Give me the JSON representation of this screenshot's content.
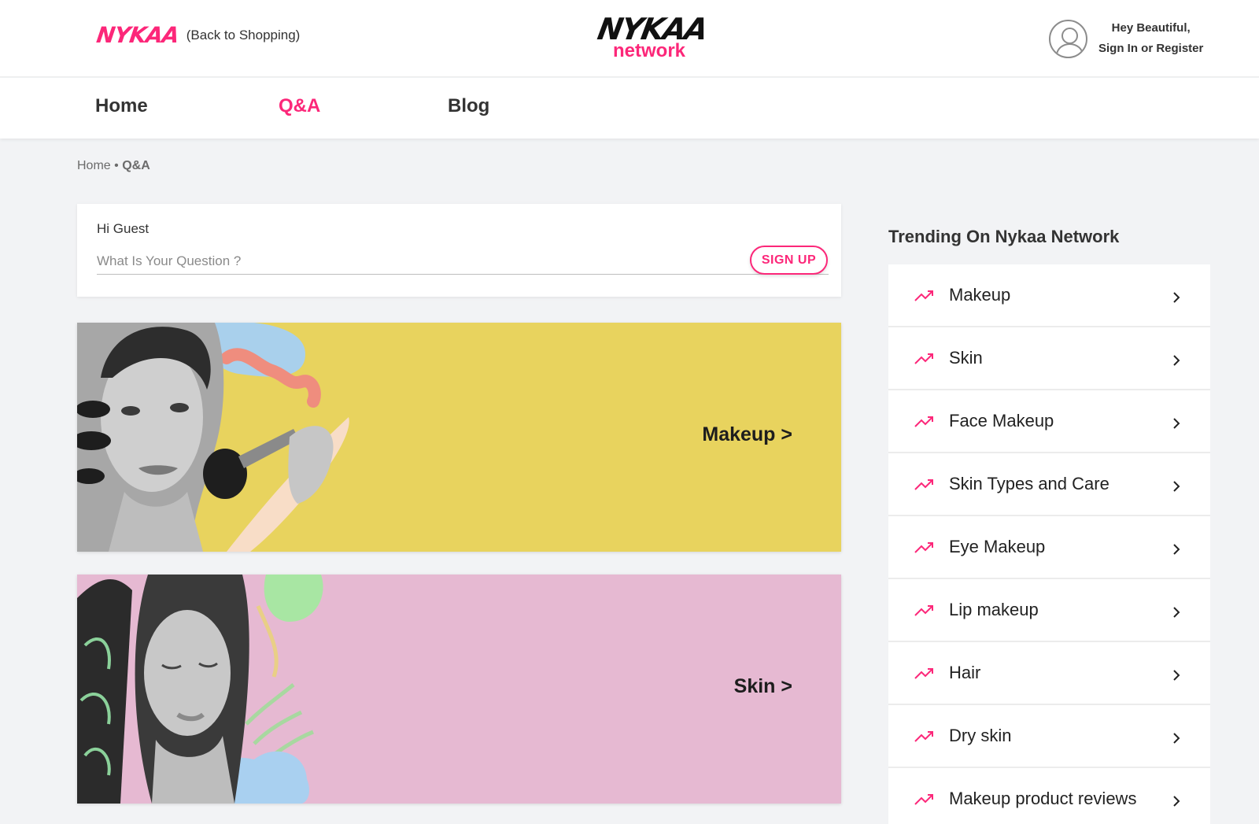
{
  "header": {
    "brand_small": "NYKAA",
    "back_link": "(Back to Shopping)",
    "logo_top": "NYKAA",
    "logo_bottom": "network",
    "user_greeting": "Hey Beautiful,",
    "user_action": "Sign In or Register"
  },
  "nav": {
    "items": [
      {
        "label": "Home"
      },
      {
        "label": "Q&A"
      },
      {
        "label": "Blog"
      }
    ],
    "active": "Q&A"
  },
  "breadcrumb": {
    "home": "Home",
    "separator": "•",
    "current": "Q&A"
  },
  "ask": {
    "greeting": "Hi Guest",
    "placeholder": "What Is Your Question ?",
    "signup_label": "SIGN UP"
  },
  "banners": [
    {
      "label": "Makeup >",
      "bg": "#e8d35e"
    },
    {
      "label": "Skin >",
      "bg": "#e6b9d2"
    }
  ],
  "trending": {
    "title": "Trending On Nykaa Network",
    "items": [
      {
        "label": "Makeup"
      },
      {
        "label": "Skin"
      },
      {
        "label": "Face Makeup"
      },
      {
        "label": "Skin Types and Care"
      },
      {
        "label": "Eye Makeup"
      },
      {
        "label": "Lip makeup"
      },
      {
        "label": "Hair"
      },
      {
        "label": "Dry skin"
      },
      {
        "label": "Makeup product reviews"
      }
    ]
  },
  "colors": {
    "accent": "#fc2779",
    "background": "#f2f3f5"
  }
}
